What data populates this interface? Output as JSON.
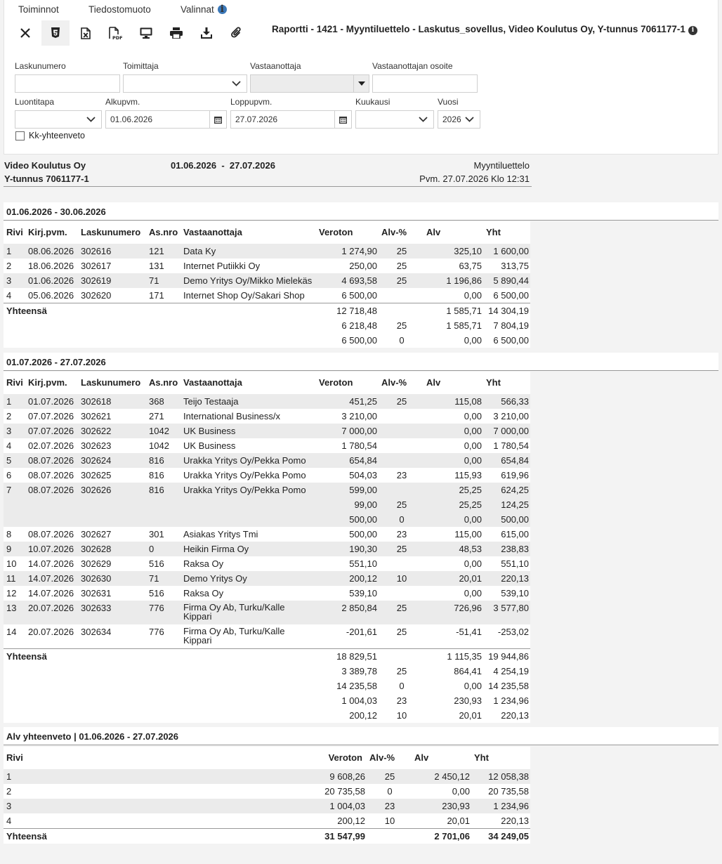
{
  "menu": {
    "actions": "Toiminnot",
    "file_format": "Tiedostomuoto",
    "options": "Valinnat"
  },
  "toolbar_icons": [
    "close-icon",
    "html5-icon",
    "excel-icon",
    "pdf-icon",
    "monitor-icon",
    "print-icon",
    "download-icon",
    "attachment-icon"
  ],
  "report_title": "Raportti - 1421 - Myyntiluettelo - Laskutus_sovellus, Video Koulutus Oy, Y-tunnus 7061177-1",
  "filters": {
    "invoice_number": {
      "label": "Laskunumero",
      "value": ""
    },
    "supplier": {
      "label": "Toimittaja",
      "value": ""
    },
    "recipient": {
      "label": "Vastaanottaja",
      "value": ""
    },
    "recipient_address": {
      "label": "Vastaanottajan osoite",
      "value": ""
    },
    "creation_method": {
      "label": "Luontitapa",
      "value": ""
    },
    "start_date": {
      "label": "Alkupvm.",
      "value": "01.06.2026"
    },
    "end_date": {
      "label": "Loppupvm.",
      "value": "27.07.2026"
    },
    "month": {
      "label": "Kuukausi",
      "value": ""
    },
    "year": {
      "label": "Vuosi",
      "value": "2026"
    },
    "monthly_summary": {
      "label": "Kk-yhteenveto",
      "checked": false
    }
  },
  "report_header": {
    "company": "Video Koulutus Oy",
    "business_id": "Y-tunnus 7061177-1",
    "period_start": "01.06.2026",
    "period_sep": "-",
    "period_end": "27.07.2026",
    "report_name": "Myyntiluettelo",
    "date_line": "Pvm. 27.07.2026 Klo 12:31"
  },
  "columns": [
    "Rivi",
    "Kirj.pvm.",
    "Laskunumero",
    "As.nro",
    "Vastaanottaja",
    "Veroton",
    "Alv-%",
    "Alv",
    "Yht"
  ],
  "sections": [
    {
      "title": "01.06.2026 - 30.06.2026",
      "rows": [
        [
          "1",
          "08.06.2026",
          "302616",
          "121",
          "Data Ky",
          "1 274,90",
          "25",
          "325,10",
          "1 600,00"
        ],
        [
          "2",
          "18.06.2026",
          "302617",
          "131",
          "Internet Putiikki Oy",
          "250,00",
          "25",
          "63,75",
          "313,75"
        ],
        [
          "3",
          "01.06.2026",
          "302619",
          "71",
          "Demo Yritys Oy/Mikko Mielekäs",
          "4 693,58",
          "25",
          "1 196,86",
          "5 890,44"
        ],
        [
          "4",
          "05.06.2026",
          "302620",
          "171",
          "Internet Shop Oy/Sakari Shop",
          "6 500,00",
          "",
          "0,00",
          "6 500,00"
        ]
      ],
      "total_label": "Yhteensä",
      "totals": [
        [
          "12 718,48",
          "",
          "1 585,71",
          "14 304,19"
        ],
        [
          "6 218,48",
          "25",
          "1 585,71",
          "7 804,19"
        ],
        [
          "6 500,00",
          "0",
          "0,00",
          "6 500,00"
        ]
      ]
    },
    {
      "title": "01.07.2026 - 27.07.2026",
      "rows": [
        [
          "1",
          "01.07.2026",
          "302618",
          "368",
          "Teijo Testaaja",
          "451,25",
          "25",
          "115,08",
          "566,33"
        ],
        [
          "2",
          "07.07.2026",
          "302621",
          "271",
          "International Business/x",
          "3 210,00",
          "",
          "0,00",
          "3 210,00"
        ],
        [
          "3",
          "07.07.2026",
          "302622",
          "1042",
          "UK Business",
          "7 000,00",
          "",
          "0,00",
          "7 000,00"
        ],
        [
          "4",
          "02.07.2026",
          "302623",
          "1042",
          "UK Business",
          "1 780,54",
          "",
          "0,00",
          "1 780,54"
        ],
        [
          "5",
          "08.07.2026",
          "302624",
          "816",
          "Urakka Yritys Oy/Pekka Pomo",
          "654,84",
          "",
          "0,00",
          "654,84"
        ],
        [
          "6",
          "08.07.2026",
          "302625",
          "816",
          "Urakka Yritys Oy/Pekka Pomo",
          "504,03",
          "23",
          "115,93",
          "619,96"
        ],
        [
          "7",
          "08.07.2026",
          "302626",
          "816",
          "Urakka Yritys Oy/Pekka Pomo",
          "599,00",
          "",
          "25,25",
          "624,25"
        ],
        [
          "",
          "",
          "",
          "",
          "",
          "99,00",
          "25",
          "25,25",
          "124,25"
        ],
        [
          "",
          "",
          "",
          "",
          "",
          "500,00",
          "0",
          "0,00",
          "500,00"
        ],
        [
          "8",
          "08.07.2026",
          "302627",
          "301",
          "Asiakas Yritys Tmi",
          "500,00",
          "23",
          "115,00",
          "615,00"
        ],
        [
          "9",
          "10.07.2026",
          "302628",
          "0",
          "Heikin Firma Oy",
          "190,30",
          "25",
          "48,53",
          "238,83"
        ],
        [
          "10",
          "14.07.2026",
          "302629",
          "516",
          "Raksa Oy",
          "551,10",
          "",
          "0,00",
          "551,10"
        ],
        [
          "11",
          "14.07.2026",
          "302630",
          "71",
          "Demo Yritys Oy",
          "200,12",
          "10",
          "20,01",
          "220,13"
        ],
        [
          "12",
          "14.07.2026",
          "302631",
          "516",
          "Raksa Oy",
          "539,10",
          "",
          "0,00",
          "539,10"
        ],
        [
          "13",
          "20.07.2026",
          "302633",
          "776",
          "Firma Oy Ab, Turku/Kalle Kippari",
          "2 850,84",
          "25",
          "726,96",
          "3 577,80"
        ],
        [
          "14",
          "20.07.2026",
          "302634",
          "776",
          "Firma Oy Ab, Turku/Kalle Kippari",
          "-201,61",
          "25",
          "-51,41",
          "-253,02"
        ]
      ],
      "total_label": "Yhteensä",
      "totals": [
        [
          "18 829,51",
          "",
          "1 115,35",
          "19 944,86"
        ],
        [
          "3 389,78",
          "25",
          "864,41",
          "4 254,19"
        ],
        [
          "14 235,58",
          "0",
          "0,00",
          "14 235,58"
        ],
        [
          "1 004,03",
          "23",
          "230,93",
          "1 234,96"
        ],
        [
          "200,12",
          "10",
          "20,01",
          "220,13"
        ]
      ]
    }
  ],
  "vat_summary": {
    "title": "Alv yhteenveto | 01.06.2026 - 27.07.2026",
    "columns": [
      "Rivi",
      "Veroton",
      "Alv-%",
      "Alv",
      "Yht"
    ],
    "rows": [
      [
        "1",
        "9 608,26",
        "25",
        "2 450,12",
        "12 058,38"
      ],
      [
        "2",
        "20 735,58",
        "0",
        "0,00",
        "20 735,58"
      ],
      [
        "3",
        "1 004,03",
        "23",
        "230,93",
        "1 234,96"
      ],
      [
        "4",
        "200,12",
        "10",
        "20,01",
        "220,13"
      ]
    ],
    "total_label": "Yhteensä",
    "totals": [
      "31 547,99",
      "",
      "2 701,06",
      "34 249,05"
    ]
  }
}
